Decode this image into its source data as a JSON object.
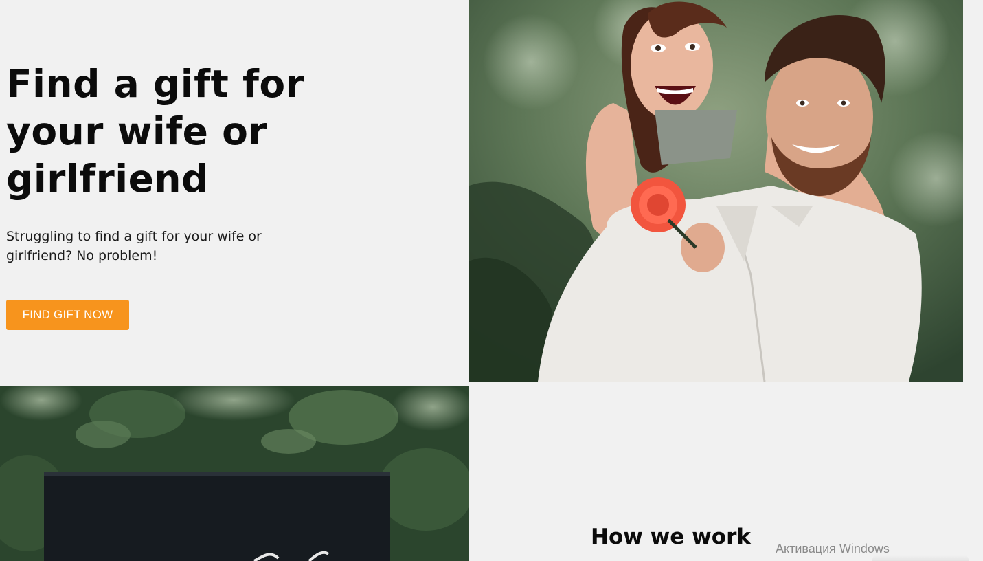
{
  "hero": {
    "title": "Find a gift for your wife or girlfriend",
    "subtitle": "Struggling to find a gift for your wife or girlfriend? No problem!",
    "cta_label": "FIND GIFT NOW"
  },
  "how_we_work": {
    "title": "How we work"
  },
  "os_watermark": {
    "text": "Активация Windows"
  },
  "colors": {
    "page_background": "#f1f1f1",
    "cta_background": "#f7941d",
    "cta_text": "#ffffff",
    "heading_text": "#0b0b0b"
  }
}
